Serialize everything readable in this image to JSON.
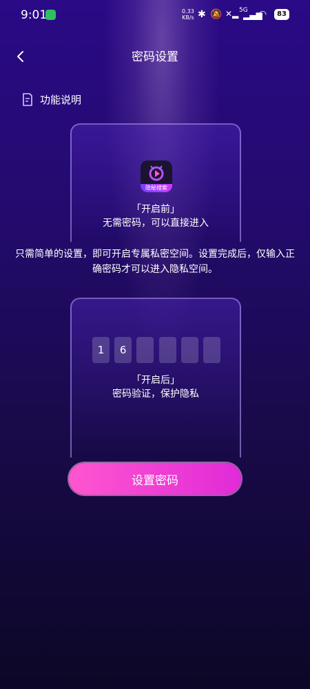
{
  "status_bar": {
    "time": "9:01",
    "net_speed_value": "0.33",
    "net_speed_unit": "KB/s",
    "signal_label": "5G",
    "battery": "83"
  },
  "header": {
    "title": "密码设置"
  },
  "feature": {
    "label": "功能说明"
  },
  "card_before": {
    "app_name": "隐秘搜索",
    "tag": "「开启前」",
    "caption": "无需密码，可以直接进入"
  },
  "description": "只需简单的设置，即可开启专属私密空间。设置完成后，仅输入正确密码才可以进入隐私空间。",
  "card_after": {
    "pin_digits": [
      "1",
      "6",
      "",
      "",
      "",
      ""
    ],
    "tag": "「开启后」",
    "caption": "密码验证，保护隐私"
  },
  "action": {
    "button_label": "设置密码"
  },
  "colors": {
    "accent_start": "#ff56cf",
    "accent_end": "#e02bd8",
    "background_top": "#2a0a86",
    "background_bottom": "#0c0726"
  }
}
